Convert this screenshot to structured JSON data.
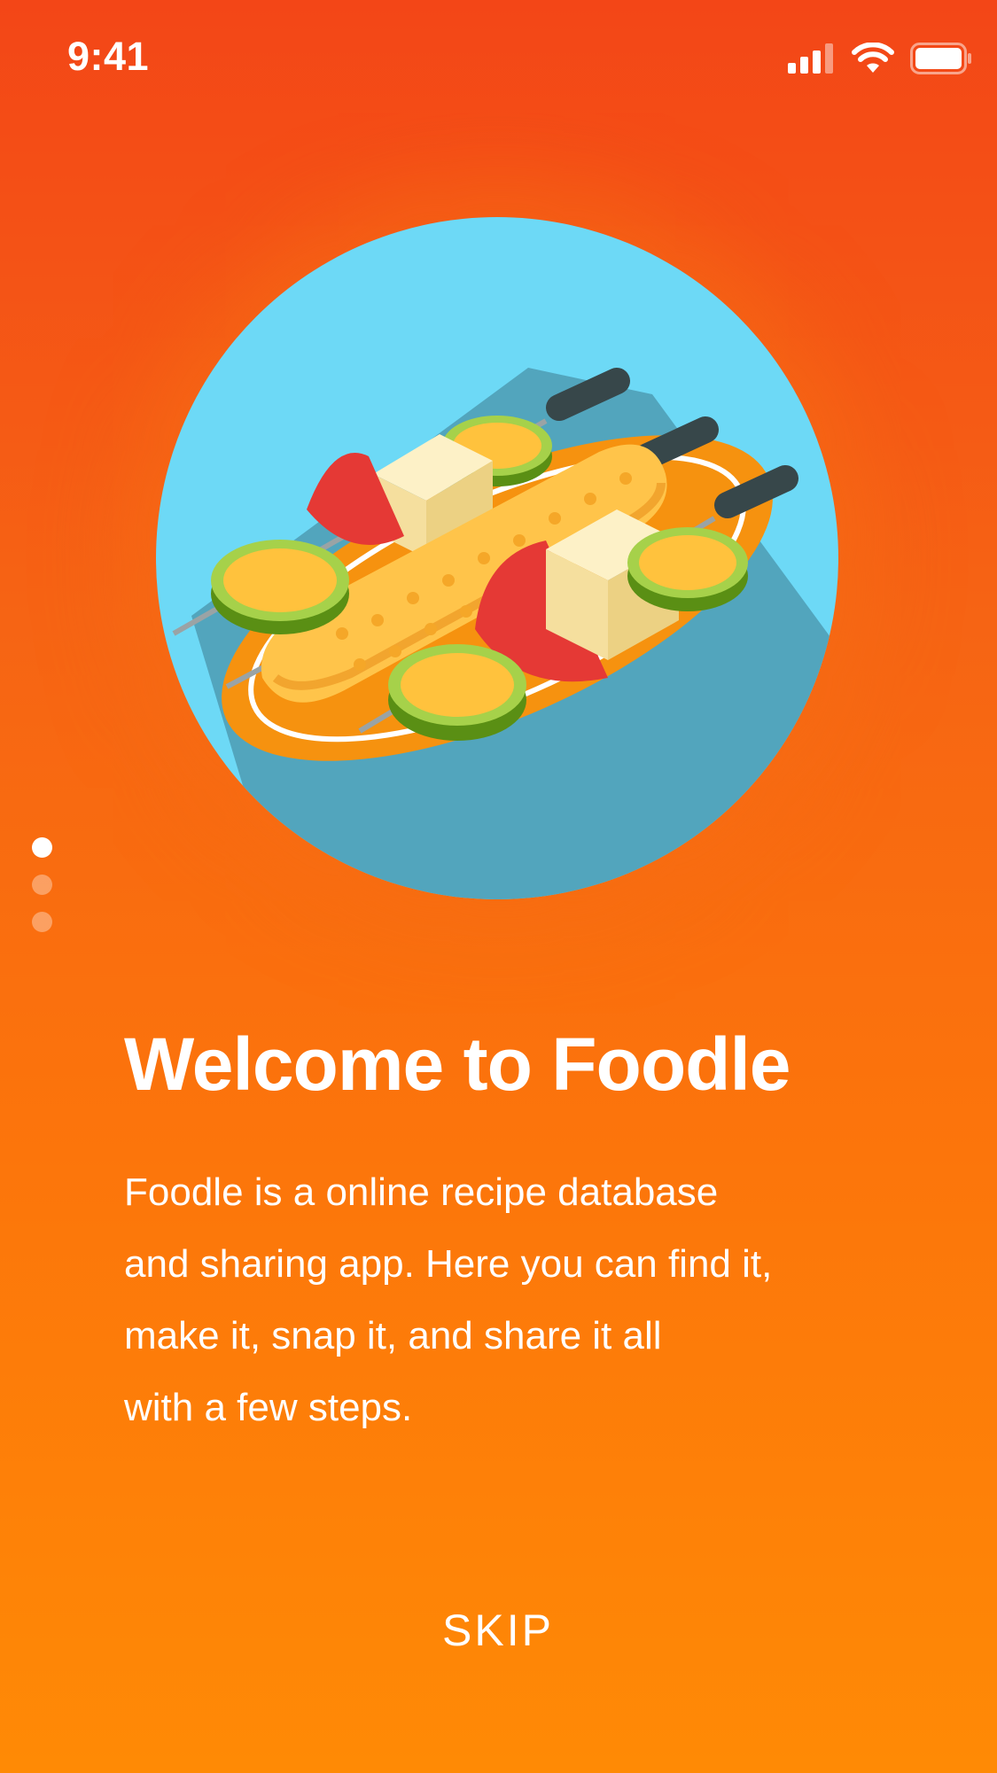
{
  "status_bar": {
    "time": "9:41",
    "icons": [
      "signal-icon",
      "wifi-icon",
      "battery-icon"
    ]
  },
  "illustration": {
    "subject": "food-skewers-illustration"
  },
  "pagination": {
    "total": 3,
    "active_index": 0
  },
  "onboarding": {
    "title": "Welcome to Foodle",
    "description_lines": [
      "Foodle is a online recipe database",
      "and sharing app. Here you can find it,",
      "make it, snap it, and share it all",
      "with a few steps."
    ],
    "skip_label": "SKIP"
  },
  "colors": {
    "gradient_top": "#f34617",
    "gradient_bottom": "#ff8a05",
    "circle": "#6dd9f6",
    "text": "#ffffff"
  }
}
